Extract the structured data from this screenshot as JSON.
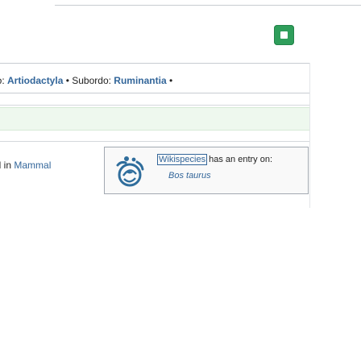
{
  "taxonomy": {
    "prefix": "rdo: ",
    "order": "Artiodactyla",
    "separator_1": " • ",
    "suborder_label": "Subordo: ",
    "suborder": "Ruminantia",
    "separator_2": " •"
  },
  "mammal_note": {
    "prefix": "ed in ",
    "link": "Mammal"
  },
  "wikispecies": {
    "link_label": "Wikispecies",
    "suffix": " has an entry on:",
    "entry": "Bos taurus"
  },
  "colors": {
    "link": "#33669a",
    "button_green": "#2f9e5b",
    "stripe_green": "#eef8ee"
  },
  "icons": {
    "top_button": "square-icon",
    "wiki_logo": "wikispecies-logo-icon"
  }
}
